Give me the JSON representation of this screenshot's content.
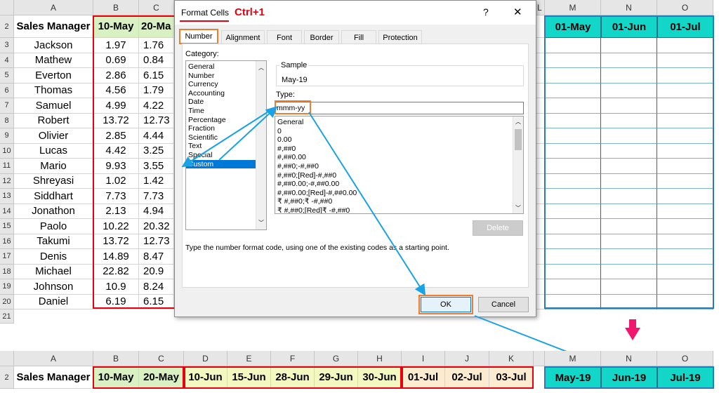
{
  "top_sheet": {
    "col_headers": [
      "A",
      "B",
      "C",
      "L",
      "M",
      "N",
      "O"
    ],
    "row_numbers": [
      "2",
      "3",
      "4",
      "5",
      "6",
      "7",
      "8",
      "9",
      "10",
      "11",
      "12",
      "13",
      "14",
      "15",
      "16",
      "17",
      "18",
      "19",
      "20",
      "21"
    ],
    "header_a": "Sales Manager",
    "header_b": "10-May",
    "header_c": "20-Ma",
    "header_m": "01-May",
    "header_n": "01-Jun",
    "header_o": "01-Jul",
    "names": [
      "Jackson",
      "Mathew",
      "Everton",
      "Thomas",
      "Samuel",
      "Robert",
      "Olivier",
      "Lucas",
      "Mario",
      "Shreyasi",
      "Siddhart",
      "Jonathon",
      "Paolo",
      "Takumi",
      "Denis",
      "Michael",
      "Johnson",
      "Daniel"
    ],
    "col_b": [
      "1.97",
      "0.69",
      "2.86",
      "4.56",
      "4.99",
      "13.72",
      "2.85",
      "4.42",
      "9.93",
      "1.02",
      "7.73",
      "2.13",
      "10.22",
      "13.72",
      "14.89",
      "22.82",
      "10.9",
      "6.19"
    ],
    "col_c": [
      "1.76",
      "0.84",
      "6.15",
      "1.79",
      "4.22",
      "12.73",
      "4.44",
      "3.25",
      "3.55",
      "1.42",
      "7.73",
      "4.94",
      "20.32",
      "12.73",
      "8.47",
      "20.9",
      "8.24",
      "6.15"
    ]
  },
  "bottom_sheet": {
    "col_headers": [
      "A",
      "B",
      "C",
      "D",
      "E",
      "F",
      "G",
      "H",
      "I",
      "J",
      "K",
      "M",
      "N",
      "O"
    ],
    "row_number": "2",
    "headers": [
      "Sales Manager",
      "10-May",
      "20-May",
      "10-Jun",
      "15-Jun",
      "28-Jun",
      "29-Jun",
      "30-Jun",
      "01-Jul",
      "02-Jul",
      "03-Jul"
    ],
    "headers_right": [
      "May-19",
      "Jun-19",
      "Jul-19"
    ]
  },
  "dialog": {
    "title": "Format Cells",
    "shortcut": "Ctrl+1",
    "help_glyph": "?",
    "close_glyph": "✕",
    "tabs": [
      "Number",
      "Alignment",
      "Font",
      "Border",
      "Fill",
      "Protection"
    ],
    "category_label": "Category:",
    "categories": [
      "General",
      "Number",
      "Currency",
      "Accounting",
      "Date",
      "Time",
      "Percentage",
      "Fraction",
      "Scientific",
      "Text",
      "Special",
      "Custom"
    ],
    "selected_category": "Custom",
    "sample_label": "Sample",
    "sample_value": "May-19",
    "type_label": "Type:",
    "type_value": "mmm-yy",
    "type_list": [
      "General",
      "0",
      "0.00",
      "#,##0",
      "#,##0.00",
      "#,##0;-#,##0",
      "#,##0;[Red]-#,##0",
      "#,##0.00;-#,##0.00",
      "#,##0.00;[Red]-#,##0.00",
      "₹ #,##0;₹ -#,##0",
      "₹ #,##0;[Red]₹ -#,##0"
    ],
    "delete_label": "Delete",
    "hint": "Type the number format code, using one of the existing codes as a starting point.",
    "ok_label": "OK",
    "cancel_label": "Cancel"
  },
  "colors": {
    "green_header": "#d8f0c2",
    "teal_header": "#12d6c8",
    "orange_callout": "#ed7d31",
    "red_callout": "#e8000f",
    "blue_arrow": "#1aa2e6",
    "pink_arrow": "#f0186e",
    "selection_blue": "#0078d7"
  }
}
